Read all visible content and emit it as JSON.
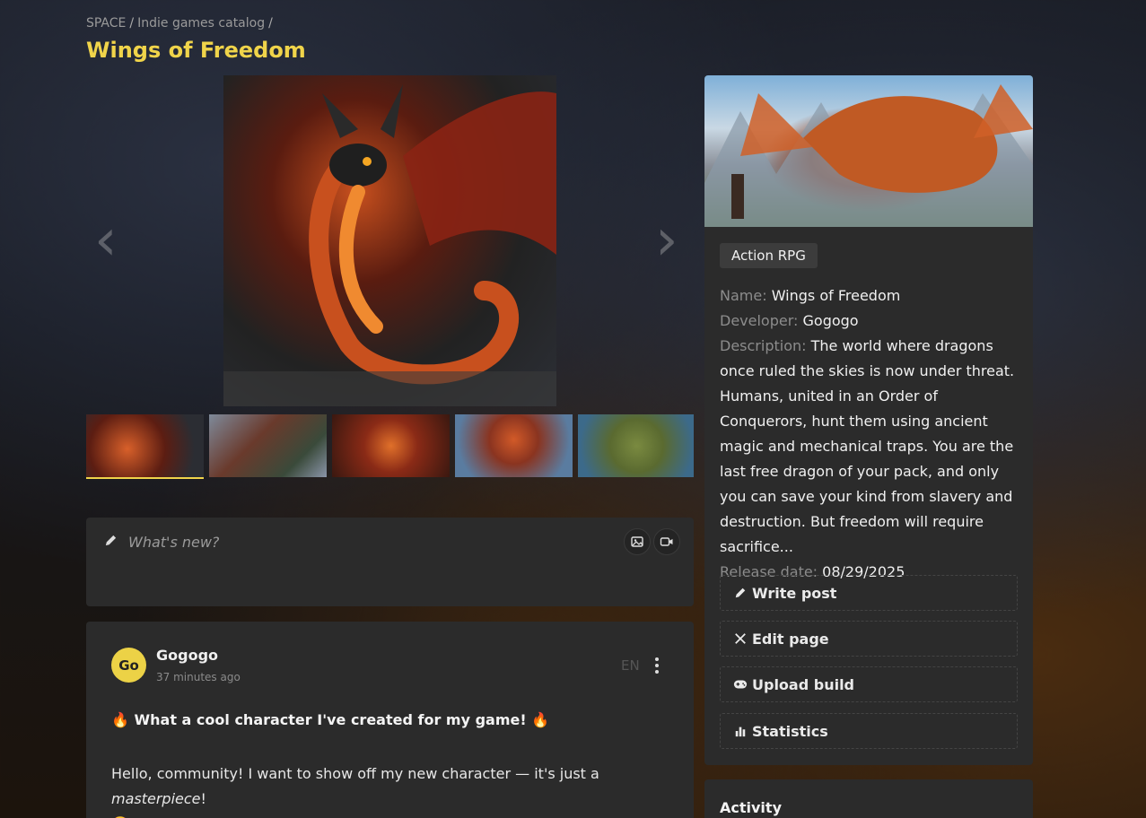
{
  "breadcrumb": {
    "root": "SPACE",
    "section": "Indie games catalog",
    "sep": "/"
  },
  "page_title": "Wings of Freedom",
  "gallery": {
    "prev_arrow": "‹",
    "next_arrow": "›",
    "thumb_count": 5,
    "active_thumb": 1
  },
  "composer": {
    "placeholder": "What's new?",
    "icons": [
      "pencil-icon",
      "image-icon",
      "video-icon"
    ]
  },
  "post": {
    "avatar_initials": "Go",
    "author": "Gogogo",
    "time": "37 minutes ago",
    "lang": "EN",
    "headline": "🔥 What a cool character I've created for my game! 🔥",
    "body_prefix": "Hello, community! I want to show off my new character — it's just a ",
    "body_emph": "masterpiece",
    "body_suffix": "!",
    "body_emoji": "🤩"
  },
  "sidebar": {
    "tag": "Action RPG",
    "name_label": "Name:",
    "name_value": "Wings of Freedom",
    "developer_label": "Developer:",
    "developer_value": "Gogogo",
    "description_label": "Description:",
    "description_value": "The world where dragons once ruled the skies is now under threat. Humans, united in an Order of Conquerors, hunt them using ancient magic and mechanical traps. You are the last free dragon of your pack, and only you can save your kind from slavery and destruction. But freedom will require sacrifice...",
    "release_label": "Release date:",
    "release_value": "08/29/2025",
    "actions": {
      "write_post": "Write post",
      "edit_page": "Edit page",
      "upload_build": "Upload build",
      "statistics": "Statistics"
    }
  },
  "activity": {
    "title": "Activity"
  },
  "colors": {
    "accent": "#f0d44a",
    "card": "#2b2b2b",
    "muted": "#8c8c8c"
  }
}
